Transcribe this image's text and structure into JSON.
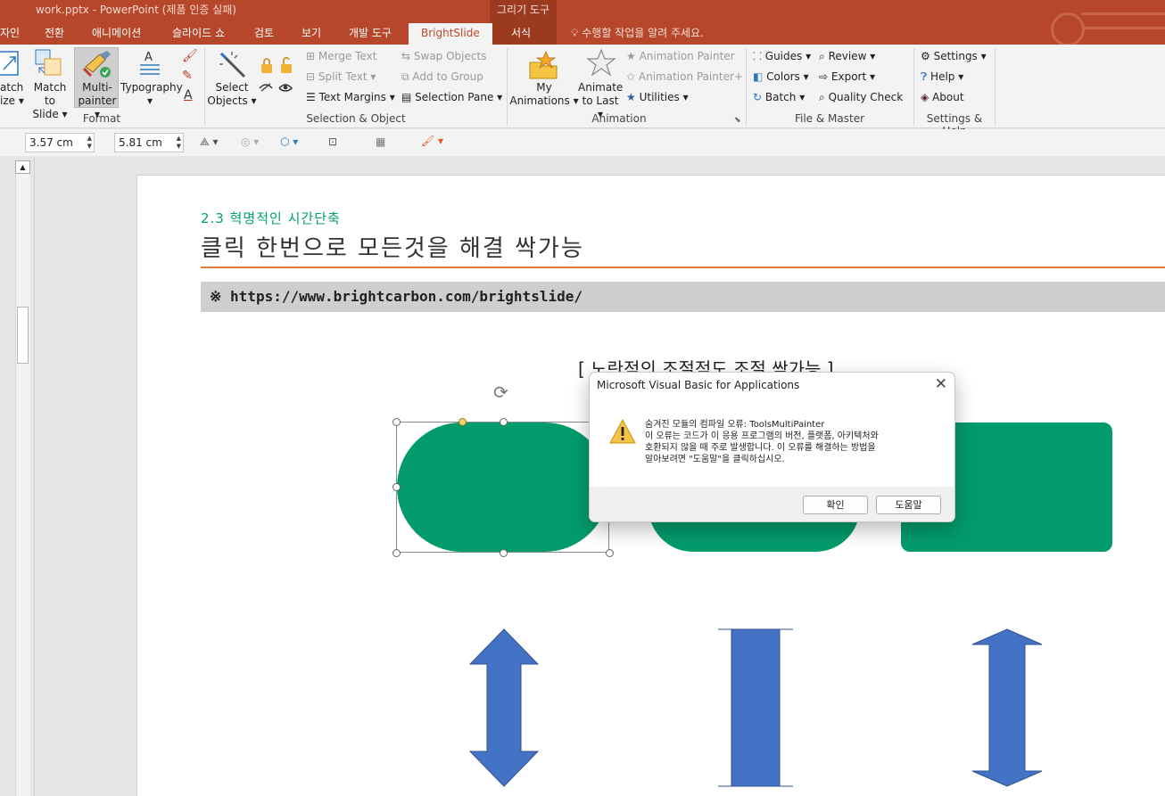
{
  "window": {
    "title": "work.pptx - PowerPoint (제품 인증 실패)",
    "contextual_group": "그리기 도구"
  },
  "tabs": [
    {
      "label": "자인"
    },
    {
      "label": "전환"
    },
    {
      "label": "애니메이션"
    },
    {
      "label": "슬라이드 쇼"
    },
    {
      "label": "검토"
    },
    {
      "label": "보기"
    },
    {
      "label": "개발 도구"
    },
    {
      "label": "BrightSlide"
    },
    {
      "label": "서식"
    }
  ],
  "tell_me": "수행할 작업을 알려 주세요.",
  "ribbon": {
    "format": {
      "group_label": "Format",
      "match_size_line1": "atch",
      "match_size_line2": "ize ▾",
      "match_to_slide_line1": "Match to",
      "match_to_slide_line2": "Slide ▾",
      "multi_painter_line1": "Multi-",
      "multi_painter_line2": "painter ▾",
      "typography_label": "Typography",
      "typography_caret": "▾"
    },
    "selection": {
      "group_label": "Selection & Object",
      "select_objects_line1": "Select",
      "select_objects_line2": "Objects ▾",
      "merge_text": "Merge Text",
      "split_text": "Split Text ▾",
      "text_margins": "Text Margins ▾",
      "swap_objects": "Swap Objects",
      "add_to_group": "Add to Group",
      "selection_pane": "Selection Pane ▾"
    },
    "animation": {
      "group_label": "Animation",
      "my_animations_line1": "My",
      "my_animations_line2": "Animations ▾",
      "animate_to_last_line1": "Animate",
      "animate_to_last_line2": "to Last ▾",
      "animation_painter": "Animation Painter",
      "animation_painter_plus": "Animation Painter+",
      "utilities": "Utilities ▾"
    },
    "file_master": {
      "group_label": "File & Master",
      "guides": "Guides ▾",
      "colors": "Colors ▾",
      "batch": "Batch ▾",
      "review": "Review ▾",
      "export": "Export ▾",
      "quality_check": "Quality Check"
    },
    "settings_help": {
      "group_label": "Settings & Help",
      "settings": "Settings ▾",
      "help": "Help ▾",
      "about": "About"
    }
  },
  "format_bar": {
    "height_value": "3.57 cm",
    "width_value": "5.81 cm"
  },
  "slide": {
    "sub_heading": "2.3 혁명적인 시간단축",
    "main_heading": "클릭 한번으로 모든것을 해결 싹가능",
    "url_line": "※ https://www.brightcarbon.com/brightslide/",
    "caption": "[ 노란점의 조절점도 조절 싹가능 ]"
  },
  "dialog": {
    "title": "Microsoft Visual Basic for Applications",
    "message_lines": [
      "숨겨진 모듈의 컴파일 오류: ToolsMultiPainter",
      " 이 오류는 코드가 이 응용 프로그램의 버전, 플랫폼, 아키텍처와",
      "호환되지 않을 때 주로 발생합니다. 이 오류를 해결하는 방법을",
      "알아보려면 \"도움말\"을 클릭하십시오."
    ],
    "ok_label": "확인",
    "help_label": "도움말"
  },
  "colors": {
    "titlebar": "#b7472a",
    "shape_green": "#039b6b",
    "arrow_blue": "#4472c4",
    "heading_green": "#00a070",
    "rule_orange": "#e07b39"
  }
}
